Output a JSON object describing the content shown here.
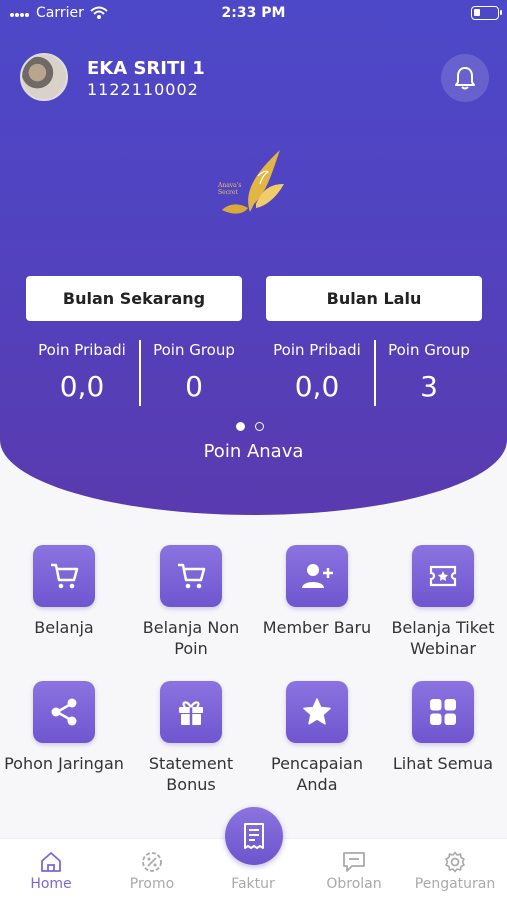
{
  "status_bar": {
    "carrier": "Carrier",
    "time": "2:33 PM"
  },
  "profile": {
    "name": "EKA SRITI 1",
    "id": "1122110002"
  },
  "logo": {
    "line1": "Anava's",
    "line2": "Secret"
  },
  "periods": [
    {
      "label": "Bulan Sekarang",
      "poin_pribadi_label": "Poin Pribadi",
      "poin_pribadi": "0,0",
      "poin_group_label": "Poin Group",
      "poin_group": "0"
    },
    {
      "label": "Bulan Lalu",
      "poin_pribadi_label": "Poin Pribadi",
      "poin_pribadi": "0,0",
      "poin_group_label": "Poin Group",
      "poin_group": "3"
    }
  ],
  "carousel": {
    "pages": 2,
    "active": 0
  },
  "section_title": "Poin Anava",
  "menu": [
    {
      "label": "Belanja",
      "icon": "cart-icon"
    },
    {
      "label": "Belanja Non Poin",
      "icon": "cart-icon"
    },
    {
      "label": "Member Baru",
      "icon": "add-user-icon"
    },
    {
      "label": "Belanja Tiket Webinar",
      "icon": "ticket-icon"
    },
    {
      "label": "Pohon Jaringan",
      "icon": "share-icon"
    },
    {
      "label": "Statement Bonus",
      "icon": "gift-icon"
    },
    {
      "label": "Pencapaian Anda",
      "icon": "star-icon"
    },
    {
      "label": "Lihat Semua",
      "icon": "grid-icon"
    }
  ],
  "tabs": [
    {
      "label": "Home",
      "icon": "home-icon",
      "active": true
    },
    {
      "label": "Promo",
      "icon": "promo-icon"
    },
    {
      "label": "Faktur",
      "icon": "receipt-icon"
    },
    {
      "label": "Obrolan",
      "icon": "chat-icon"
    },
    {
      "label": "Pengaturan",
      "icon": "gear-icon"
    }
  ],
  "colors": {
    "primary": "#5143c0",
    "accent": "#7b68d9",
    "gold": "#e9c25a"
  }
}
